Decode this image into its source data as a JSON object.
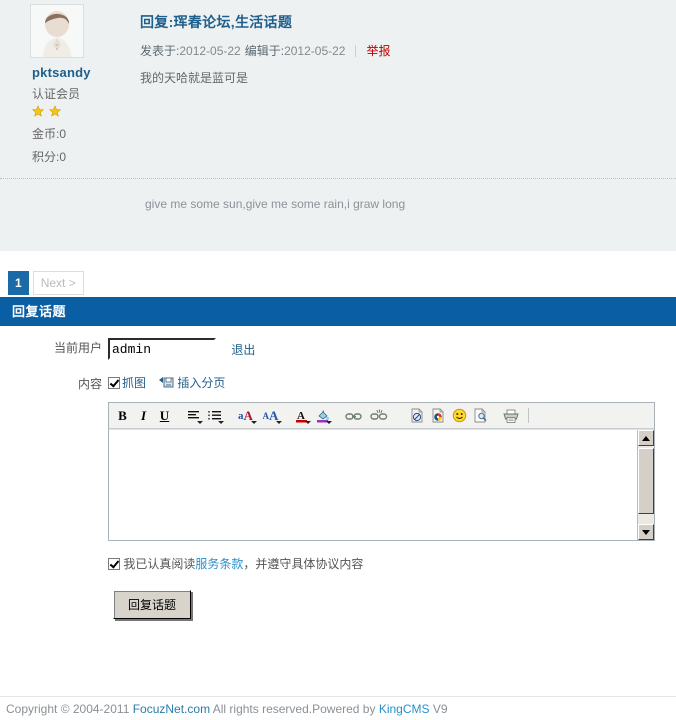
{
  "post": {
    "user": {
      "avatar_icon": "user-avatar-icon",
      "name": "pktsandy",
      "group": "认证会员",
      "stars": 2,
      "coins_label": "金币:0",
      "points_label": "积分:0"
    },
    "title": "回复:珲春论坛,生活话题",
    "posted_label": "发表于:",
    "posted_date": "2012-05-22",
    "edited_label": "编辑于:",
    "edited_date": "2012-05-22",
    "report_label": "举报",
    "content": "我的天哈就是蓝可是",
    "signature": "give me some sun,give me some rain,i graw long"
  },
  "pager": {
    "current": "1",
    "next_label": "Next >"
  },
  "reply": {
    "header": "回复话题",
    "user_label": "当前用户",
    "user_value": "admin",
    "logout_label": "退出",
    "content_label": "内容",
    "capture_label": "抓图",
    "capture_icon": "checkbox-checked-icon",
    "pagebreak_label": "插入分页",
    "pagebreak_icon": "insert-pagebreak-icon",
    "toolbar": [
      {
        "name": "bold-icon",
        "glyph": "B",
        "dropdown": false
      },
      {
        "name": "italic-icon",
        "glyph": "I",
        "dropdown": false
      },
      {
        "name": "underline-icon",
        "glyph": "U",
        "dropdown": false
      },
      {
        "name": "align-icon",
        "glyph": "",
        "dropdown": true
      },
      {
        "name": "list-icon",
        "glyph": "",
        "dropdown": true
      },
      {
        "name": "case-change-icon",
        "glyph": "aA",
        "dropdown": true
      },
      {
        "name": "font-size-icon",
        "glyph": "AA",
        "dropdown": true
      },
      {
        "name": "font-color-icon",
        "glyph": "A",
        "dropdown": true
      },
      {
        "name": "highlight-color-icon",
        "glyph": "",
        "dropdown": true
      },
      {
        "name": "insert-link-icon",
        "glyph": "",
        "dropdown": false
      },
      {
        "name": "remove-link-icon",
        "glyph": "",
        "dropdown": false
      },
      {
        "name": "insert-flash-icon",
        "glyph": "",
        "dropdown": false
      },
      {
        "name": "insert-media-icon",
        "glyph": "",
        "dropdown": false
      },
      {
        "name": "insert-emoticon-icon",
        "glyph": "",
        "dropdown": false
      },
      {
        "name": "preview-icon",
        "glyph": "",
        "dropdown": false
      },
      {
        "name": "print-icon",
        "glyph": "",
        "dropdown": false
      }
    ],
    "editor_value": "",
    "terms_checked": true,
    "terms_prefix": "我已认真阅读",
    "terms_link": "服务条款",
    "terms_suffix": "，并遵守具体协议内容",
    "submit_label": "回复话题"
  },
  "footer": {
    "copyright": "Copyright © 2004-2011 ",
    "site": "FocuzNet.com",
    "rights": " All rights reserved.Powered by ",
    "cms": "KingCMS",
    "version": " V9"
  },
  "colors": {
    "accent": "#0a5fa4",
    "link": "#1f5f8b",
    "danger": "#c00000",
    "post_bg": "#eef1f2"
  }
}
